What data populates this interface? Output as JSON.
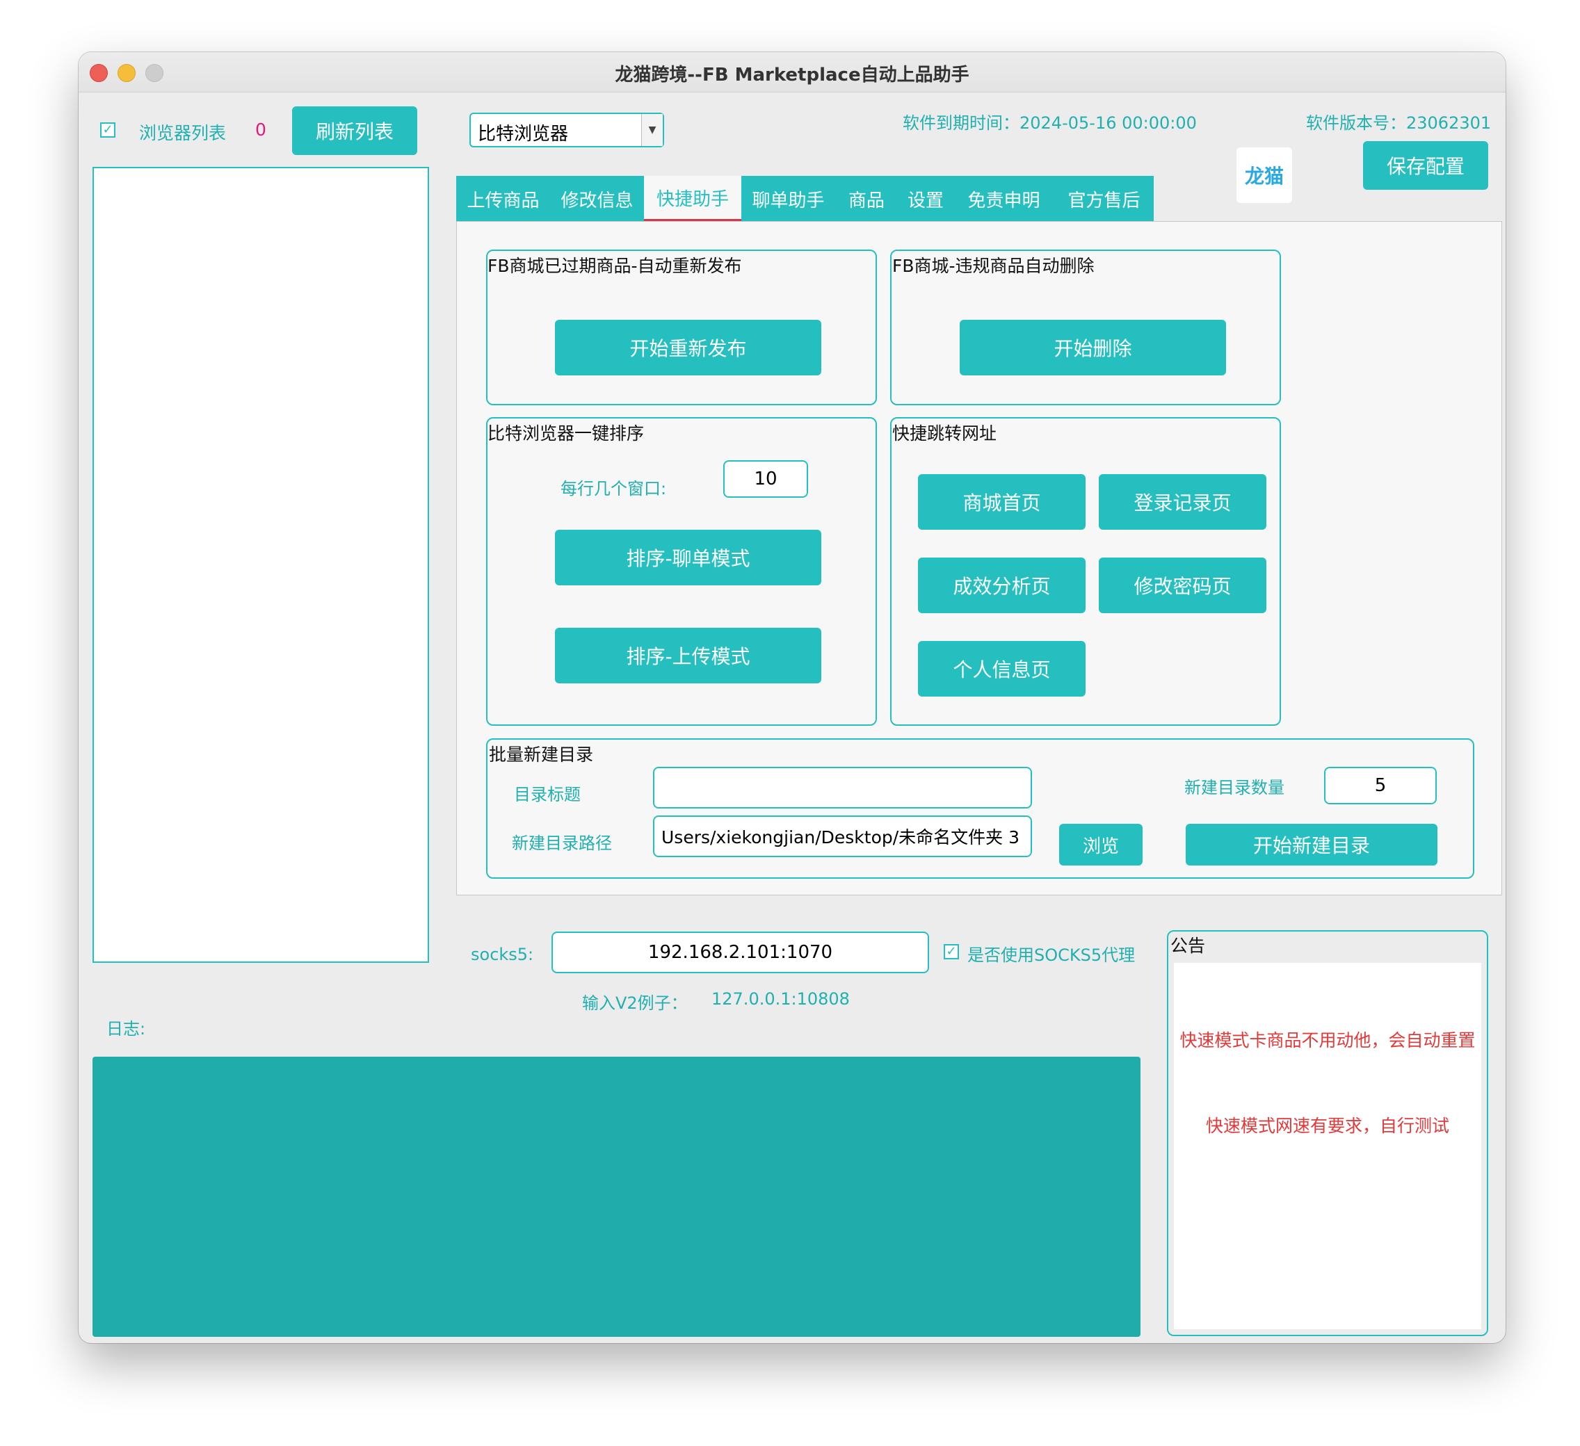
{
  "window": {
    "title": "龙猫跨境--FB Marketplace自动上品助手"
  },
  "left": {
    "browser_list_label": "浏览器列表",
    "browser_count": "0",
    "refresh_button": "刷新列表",
    "checkbox_mark": "✓"
  },
  "top": {
    "browser_select_value": "比特浏览器",
    "expiry_label": "软件到期时间：",
    "expiry_value": "2024-05-16 00:00:00",
    "version_label": "软件版本号：",
    "version_value": "23062301",
    "logo_text": "龙猫",
    "save_button": "保存配置"
  },
  "tabs": [
    "上传商品",
    "修改信息",
    "快捷助手",
    "聊单助手",
    "商品",
    "设置",
    "免责申明",
    "官方售后"
  ],
  "groups": {
    "republish": {
      "title": "FB商城已过期商品-自动重新发布",
      "button": "开始重新发布"
    },
    "delete": {
      "title": "FB商城-违规商品自动删除",
      "button": "开始删除"
    },
    "sort": {
      "title": "比特浏览器一键排序",
      "per_row_label": "每行几个窗口:",
      "per_row_value": "10",
      "chat_mode_button": "排序-聊单模式",
      "upload_mode_button": "排序-上传模式"
    },
    "jump": {
      "title": "快捷跳转网址",
      "buttons": [
        "商城首页",
        "登录记录页",
        "成效分析页",
        "修改密码页",
        "个人信息页"
      ]
    },
    "batch_dir": {
      "title": "批量新建目录",
      "dir_title_label": "目录标题",
      "dir_title_value": "",
      "count_label": "新建目录数量",
      "count_value": "5",
      "path_label": "新建目录路径",
      "path_value": "Users/xiekongjian/Desktop/未命名文件夹 3",
      "browse_button": "浏览",
      "start_button": "开始新建目录"
    }
  },
  "proxy": {
    "label": "socks5:",
    "value": "192.168.2.101:1070",
    "use_label": "是否使用SOCKS5代理",
    "example_label": "输入V2例子：",
    "example_value": "127.0.0.1:10808"
  },
  "log": {
    "label": "日志:"
  },
  "notice": {
    "title": "公告",
    "line1": "快速模式卡商品不用动他，会自动重置",
    "line2": "快速模式网速有要求，自行测试"
  }
}
